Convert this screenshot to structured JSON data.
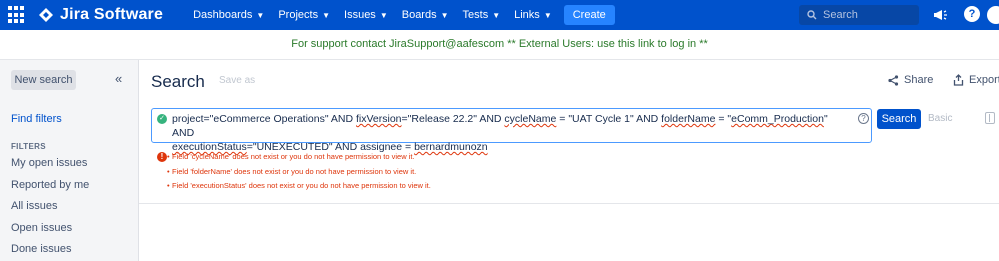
{
  "nav": {
    "product": "Jira Software",
    "items": [
      {
        "label": "Dashboards"
      },
      {
        "label": "Projects"
      },
      {
        "label": "Issues"
      },
      {
        "label": "Boards"
      },
      {
        "label": "Tests"
      },
      {
        "label": "Links"
      }
    ],
    "create_label": "Create",
    "search_placeholder": "Search"
  },
  "banner": {
    "text": "For support contact JiraSupport@aafescom ** External Users: use this link to log in **"
  },
  "sidebar": {
    "new_search_label": "New search",
    "collapse_glyph": "«",
    "find_filters_label": "Find filters",
    "filters_heading": "FILTERS",
    "filters": [
      {
        "label": "My open issues"
      },
      {
        "label": "Reported by me"
      },
      {
        "label": "All issues"
      },
      {
        "label": "Open issues"
      },
      {
        "label": "Done issues"
      }
    ]
  },
  "main": {
    "title": "Search",
    "save_as_label": "Save as",
    "share_label": "Share",
    "export_label": "Export",
    "query": {
      "p1": "project=\"eCommerce Operations\" AND ",
      "p2": "fixVersion",
      "p3": "=\"Release 22.2\" AND ",
      "p4": "cycleName",
      "p5": " = \"UAT Cycle 1\" AND ",
      "p6": "folderName",
      "p7": " = \"",
      "p8": "eComm_Production",
      "p9": "\" AND",
      "p10": "executionStatus",
      "p11": "=\"UNEXECUTED\" AND assignee = ",
      "p12": "bernardmunozn"
    },
    "search_button_label": "Search",
    "basic_label": "Basic",
    "errors": [
      {
        "text": "Field 'cycleName' does not exist or you do not have permission to view it."
      },
      {
        "text": "Field 'folderName' does not exist or you do not have permission to view it."
      },
      {
        "text": "Field 'executionStatus' does not exist or you do not have permission to view it."
      }
    ]
  },
  "colors": {
    "nav_bg": "#0052cc",
    "banner_text": "#2a7a2a",
    "error": "#de350b",
    "valid": "#36b37e"
  }
}
